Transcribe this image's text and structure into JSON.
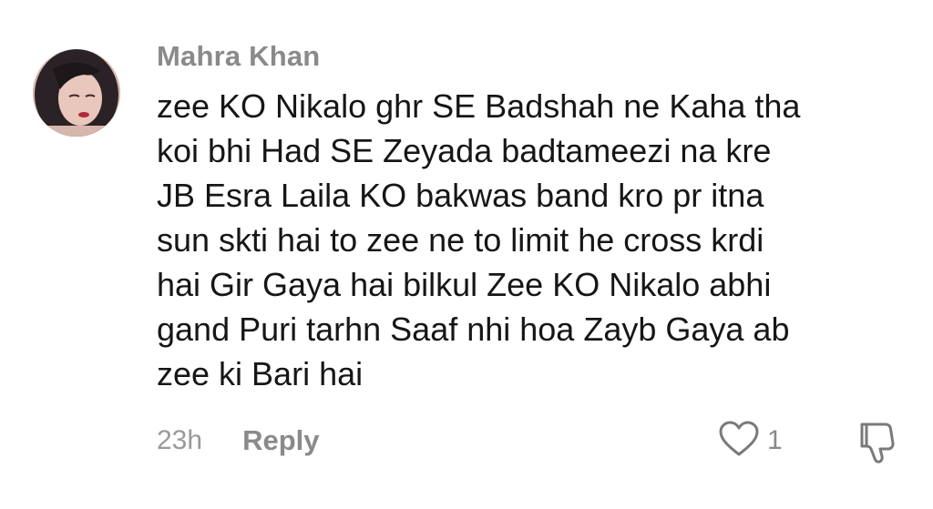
{
  "comment": {
    "username": "Mahra Khan",
    "lines": [
      "zee KO Nikalo ghr SE Badshah ne Kaha tha",
      "koi bhi Had SE Zeyada badtameezi na kre",
      "JB Esra Laila KO bakwas band kro pr itna",
      "sun skti hai to zee ne to limit he cross krdi",
      "hai Gir Gaya hai bilkul Zee KO Nikalo abhi",
      "gand Puri tarhn Saaf nhi hoa Zayb Gaya ab",
      "zee ki Bari hai"
    ],
    "timestamp": "23h",
    "reply_label": "Reply",
    "like_count": "1",
    "icons": {
      "like": "heart-outline-icon",
      "dislike": "thumbs-down-outline-icon"
    }
  }
}
